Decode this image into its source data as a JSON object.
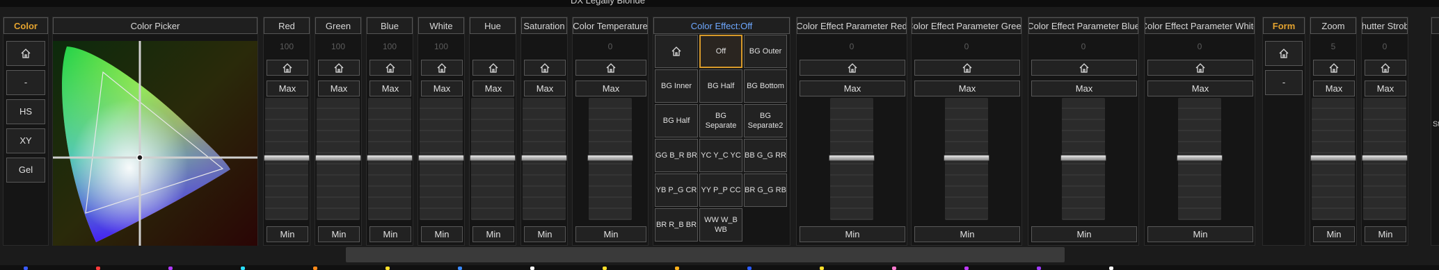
{
  "window": {
    "title": "DX Legally Blonde"
  },
  "side_left": {
    "header": "Color",
    "buttons": [
      "-",
      "HS",
      "XY",
      "Gel"
    ]
  },
  "color_picker": {
    "header": "Color Picker"
  },
  "channels": [
    {
      "name": "Red",
      "value": "100",
      "max": "Max",
      "min": "Min"
    },
    {
      "name": "Green",
      "value": "100",
      "max": "Max",
      "min": "Min"
    },
    {
      "name": "Blue",
      "value": "100",
      "max": "Max",
      "min": "Min"
    },
    {
      "name": "White",
      "value": "100",
      "max": "Max",
      "min": "Min"
    },
    {
      "name": "Hue",
      "value": "",
      "max": "Max",
      "min": "Min"
    },
    {
      "name": "Saturation",
      "value": "",
      "max": "Max",
      "min": "Min"
    },
    {
      "name": "Color Temperature",
      "value": "0",
      "max": "Max",
      "min": "Min"
    }
  ],
  "color_effect": {
    "header": "Color Effect:Off",
    "cells": [
      "Off",
      "BG Outer",
      "BG Inner",
      "BG Half",
      "BG Bottom",
      "BG Half",
      "BG Separate",
      "BG Separate2",
      "GG B_R BR",
      "YC Y_C YC",
      "BB G_G RR",
      "YB P_G CR",
      "YY P_P CC",
      "BR G_G RB",
      "BR R_B BR",
      "WW W_B WB"
    ]
  },
  "effect_params": [
    {
      "name": "Color Effect Parameter Red",
      "value": "0",
      "max": "Max",
      "min": "Min"
    },
    {
      "name": "Color Effect Parameter Green",
      "value": "0",
      "max": "Max",
      "min": "Min"
    },
    {
      "name": "Color Effect Parameter Blue",
      "value": "0",
      "max": "Max",
      "min": "Min"
    },
    {
      "name": "Color Effect Parameter White",
      "value": "0",
      "max": "Max",
      "min": "Min"
    }
  ],
  "side_right": {
    "header": "Form",
    "buttons": [
      "-"
    ]
  },
  "right_channels": [
    {
      "name": "Zoom",
      "value": "5",
      "max": "Max",
      "min": "Min"
    },
    {
      "name": "Shutter Strobe",
      "value": "0",
      "max": "Max",
      "min": "Min"
    }
  ],
  "partial_label": "St",
  "colors": {
    "accent_orange": "#e4a32f",
    "accent_blue": "#6ea8ff",
    "selected_border": "#d89a2a"
  }
}
